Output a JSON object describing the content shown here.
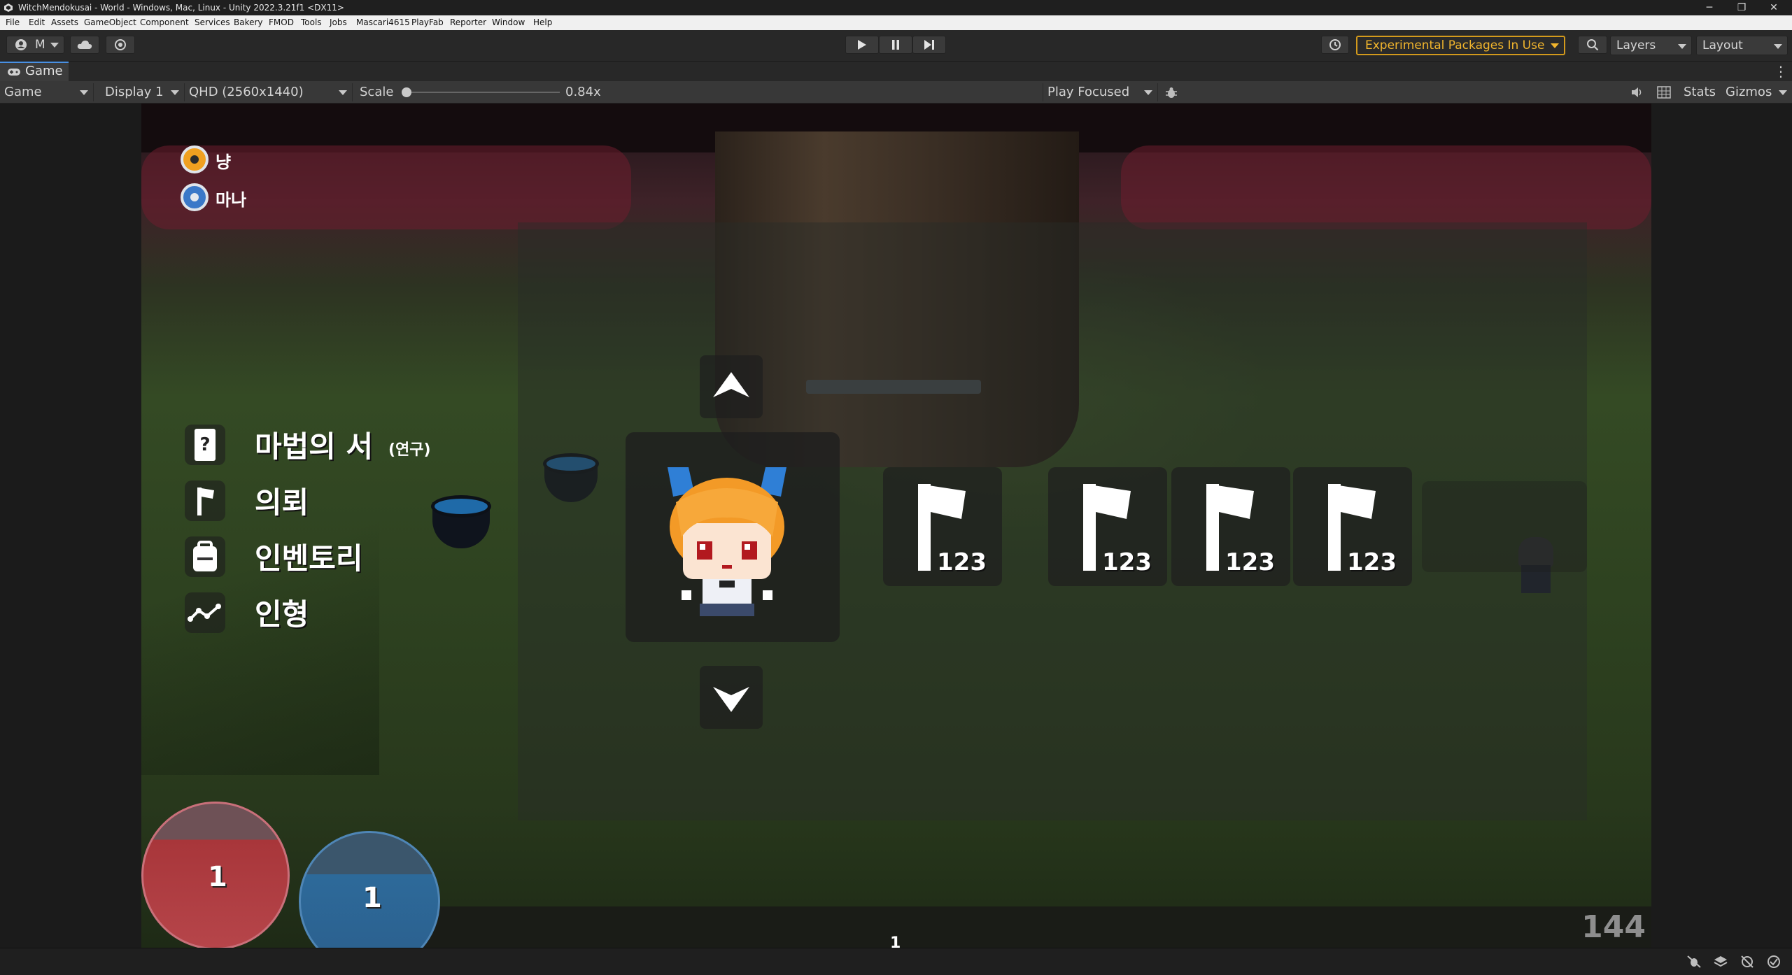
{
  "window": {
    "title": "WitchMendokusai - World - Windows, Mac, Linux - Unity 2022.3.21f1 <DX11>",
    "controls": [
      "─",
      "❐",
      "✕"
    ]
  },
  "menubar": [
    "File",
    "Edit",
    "Assets",
    "GameObject",
    "Component",
    "Services",
    "Bakery",
    "FMOD",
    "Tools",
    "Jobs",
    "Mascari4615",
    "PlayFab",
    "Reporter",
    "Window",
    "Help"
  ],
  "toolbar": {
    "account_label": "M",
    "experimental_label": "Experimental Packages In Use",
    "layers_label": "Layers",
    "layout_label": "Layout",
    "play_icon": "play-icon",
    "pause_icon": "pause-icon",
    "step_icon": "step-icon"
  },
  "game_view": {
    "tab_label": "Game",
    "view_select": "Game",
    "display_select": "Display 1",
    "resolution_select": "QHD (2560x1440)",
    "scale_label": "Scale",
    "scale_value": "0.84x",
    "scale_level": 0.84,
    "play_mode_select": "Play Focused",
    "stats_label": "Stats",
    "gizmos_label": "Gizmos"
  },
  "hud": {
    "resources": [
      {
        "label": "냥",
        "color": "#f0a020"
      },
      {
        "label": "마나",
        "color": "#3a78c8"
      }
    ],
    "menu": [
      {
        "label": "마법의 서",
        "sub": "(연구)",
        "icon": "spellbook-icon"
      },
      {
        "label": "의뢰",
        "sub": "",
        "icon": "flag-icon"
      },
      {
        "label": "인벤토리",
        "sub": "",
        "icon": "backpack-icon"
      },
      {
        "label": "인형",
        "sub": "",
        "icon": "graph-icon"
      }
    ],
    "slots": [
      {
        "qty": "123",
        "icon": "axe-icon"
      },
      {
        "qty": "123",
        "icon": "axe-icon"
      },
      {
        "qty": "123",
        "icon": "axe-icon"
      },
      {
        "qty": "123",
        "icon": "axe-icon"
      }
    ],
    "hp_value": "1",
    "mp_value": "1",
    "hp_color": "#a8363a",
    "mp_color": "#2d6a9a",
    "bottom_center": "1",
    "fps": "144"
  }
}
